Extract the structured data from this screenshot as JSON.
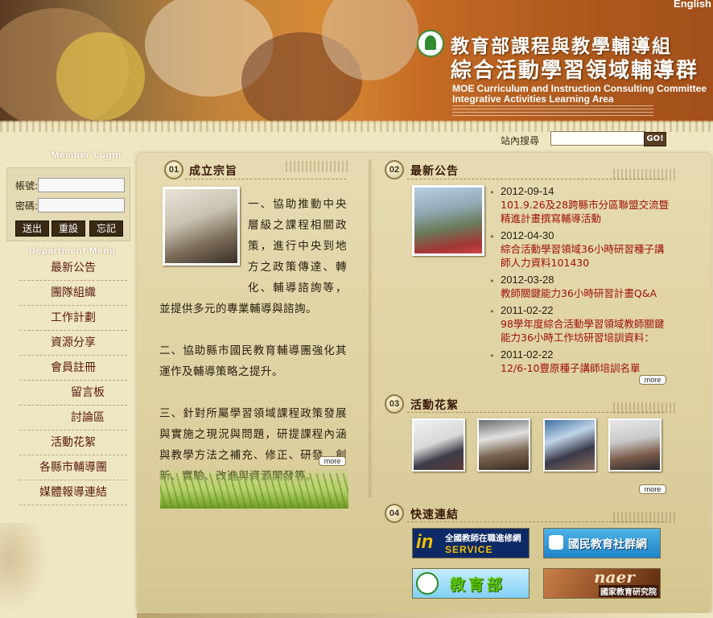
{
  "header": {
    "english_link": "English",
    "title_zh": "教育部課程與教學輔導組",
    "subtitle_zh": "綜合活動學習領域輔導群",
    "title_en_line1": "MOE Curriculum and Instruction Consulting Committee",
    "title_en_line2": "Integrative Activities Learning Area"
  },
  "search": {
    "label": "站內搜尋",
    "value": "",
    "go_label": "GO!"
  },
  "login": {
    "heading": "Member Login",
    "account_label": "帳號:",
    "password_label": "密碼:",
    "submit_label": "送出",
    "reset_label": "重設",
    "forgot_label": "忘記"
  },
  "department_menu": {
    "heading": "Department Menu",
    "items": [
      {
        "label": "最新公告"
      },
      {
        "label": "團隊組織"
      },
      {
        "label": "工作計劃"
      },
      {
        "label": "資源分享"
      },
      {
        "label": "會員註冊"
      },
      {
        "label": "留言板",
        "indent": true
      },
      {
        "label": "討論區",
        "indent": true
      },
      {
        "label": "活動花絮"
      },
      {
        "label": "各縣市輔導團"
      },
      {
        "label": "媒體報導連結"
      }
    ]
  },
  "sections": {
    "purpose": {
      "number": "01",
      "title": "成立宗旨",
      "paragraphs": [
        "一、協助推動中央層級之課程相關政策，進行中央到地方之政策傳達、轉化、輔導諮詢等，並提供多元的專業輔導與諮詢。",
        "二、協助縣市國民教育輔導團強化其運作及輔導策略之提升。",
        "三、針對所屬學習領域課程政策發展與實施之現況與問題，研提課程內涵與教學方法之補充、修正、研發、創新、實驗、改進與資源開發等。"
      ],
      "more_label": "more"
    },
    "announcements": {
      "number": "02",
      "title": "最新公告",
      "items": [
        {
          "date": "2012-09-14",
          "title": "101.9.26及28跨縣市分區聯盟交流暨精進計畫撰寫輔導活動"
        },
        {
          "date": "2012-04-30",
          "title": "綜合活動學習領域36小時研習種子講師人力資料101430"
        },
        {
          "date": "2012-03-28",
          "title": "教師關鍵能力36小時研習計畫Q&A"
        },
        {
          "date": "2011-02-22",
          "title": "98學年度綜合活動學習領域教師關鍵能力36小時工作坊研習培訓資料："
        },
        {
          "date": "2011-02-22",
          "title": "12/6-10豐原種子講師培訓名單"
        }
      ],
      "more_label": "more"
    },
    "gallery": {
      "number": "03",
      "title": "活動花絮",
      "more_label": "more"
    },
    "quick_links": {
      "number": "04",
      "title": "快速連結",
      "teacher_in": "in",
      "teacher_line1": "全國教師在職進修網",
      "teacher_line2": "SERVICE",
      "community": "國民教育社群網",
      "moe": "教育部",
      "naer_word": "naer",
      "naer_name": "國家教育研究院"
    }
  },
  "colors": {
    "background": "#efe6c2",
    "panel": "#e6dbb2",
    "announcement_title": "#a0100a",
    "menu_text": "#5a1a12"
  }
}
